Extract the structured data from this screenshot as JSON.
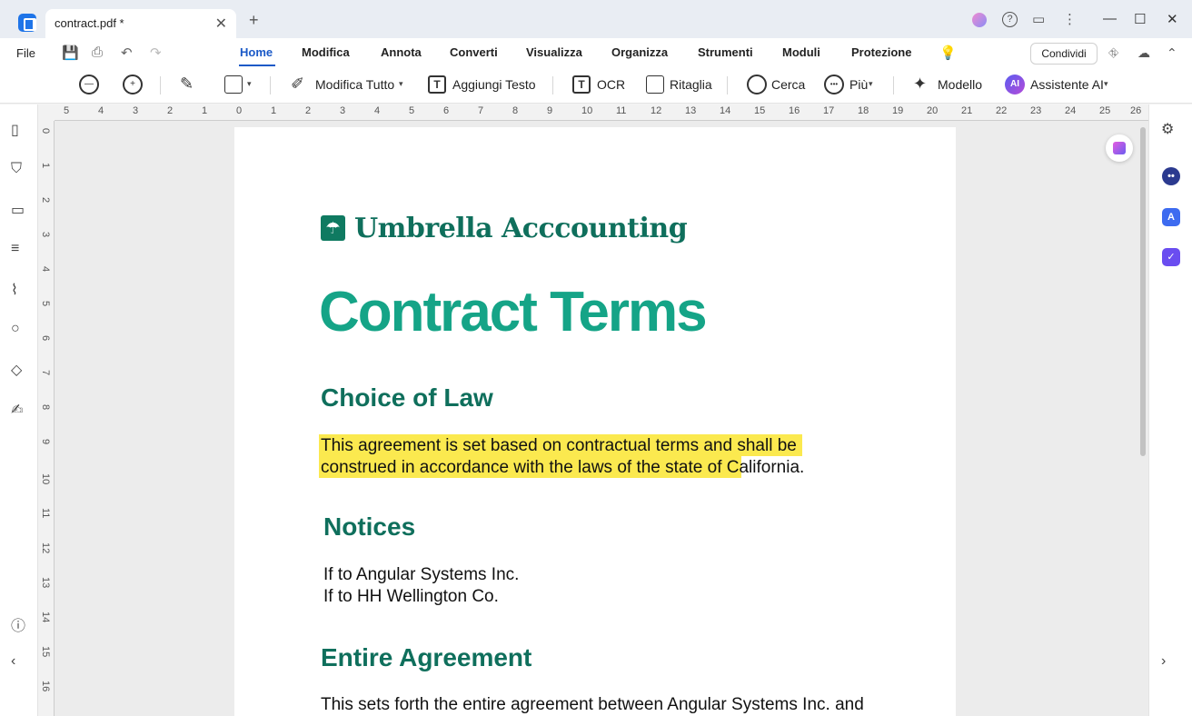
{
  "window": {
    "tab_title": "contract.pdf *",
    "tab_close": "✕",
    "tab_add": "+",
    "minimize": "—",
    "maximize": "☐",
    "close": "✕",
    "help": "?"
  },
  "menu": {
    "file": "File",
    "items": [
      "Home",
      "Modifica",
      "Annota",
      "Converti",
      "Visualizza",
      "Organizza",
      "Strumenti",
      "Moduli",
      "Protezione"
    ],
    "active": "Home",
    "share": "Condividi"
  },
  "toolbar": {
    "edit_all": "Modifica Tutto",
    "add_text": "Aggiungi Testo",
    "ocr": "OCR",
    "crop": "Ritaglia",
    "search": "Cerca",
    "more": "Più",
    "template": "Modello",
    "ai_assistant": "Assistente AI",
    "ai_badge": "AI",
    "t_glyph": "T",
    "dots": "•••"
  },
  "ruler": {
    "top_ticks": [
      "5",
      "4",
      "3",
      "2",
      "1",
      "0",
      "1",
      "2",
      "3",
      "4",
      "5",
      "6",
      "7",
      "8",
      "9",
      "10",
      "11",
      "12",
      "13",
      "14",
      "15",
      "16",
      "17",
      "18",
      "19",
      "20",
      "21",
      "22",
      "23",
      "24",
      "25",
      "26"
    ],
    "left_ticks": [
      "0",
      "1",
      "2",
      "3",
      "4",
      "5",
      "6",
      "7",
      "8",
      "9",
      "10",
      "11",
      "12",
      "13",
      "14",
      "15",
      "16"
    ]
  },
  "document": {
    "company": "Umbrella Acccounting",
    "title": "Contract Terms",
    "sections": [
      {
        "heading": "Choice of Law",
        "lines": [
          "This agreement is set based on contractual terms and shall be",
          "construed in accordance with the laws of the state of California."
        ]
      },
      {
        "heading": "Notices",
        "lines": [
          "If to Angular Systems Inc.",
          "If to HH Wellington Co."
        ]
      },
      {
        "heading": "Entire Agreement",
        "lines": [
          "This sets forth the entire agreement between Angular Systems Inc. and"
        ]
      }
    ]
  },
  "colors": {
    "accent": "#1a59c7",
    "brand_dark": "#0f6f5c",
    "brand_light": "#15a487",
    "highlight": "#fbe94f"
  },
  "icons": {
    "left_sidebar": [
      "page-icon",
      "bookmark-icon",
      "comment-icon",
      "layers-list-icon",
      "attachment-icon",
      "search-icon",
      "stack-icon",
      "signature-icon",
      "help-icon",
      "collapse-left-icon"
    ],
    "right_sidebar": [
      "properties-icon",
      "chatbot-icon",
      "translate-icon",
      "task-icon",
      "expand-right-icon"
    ]
  }
}
